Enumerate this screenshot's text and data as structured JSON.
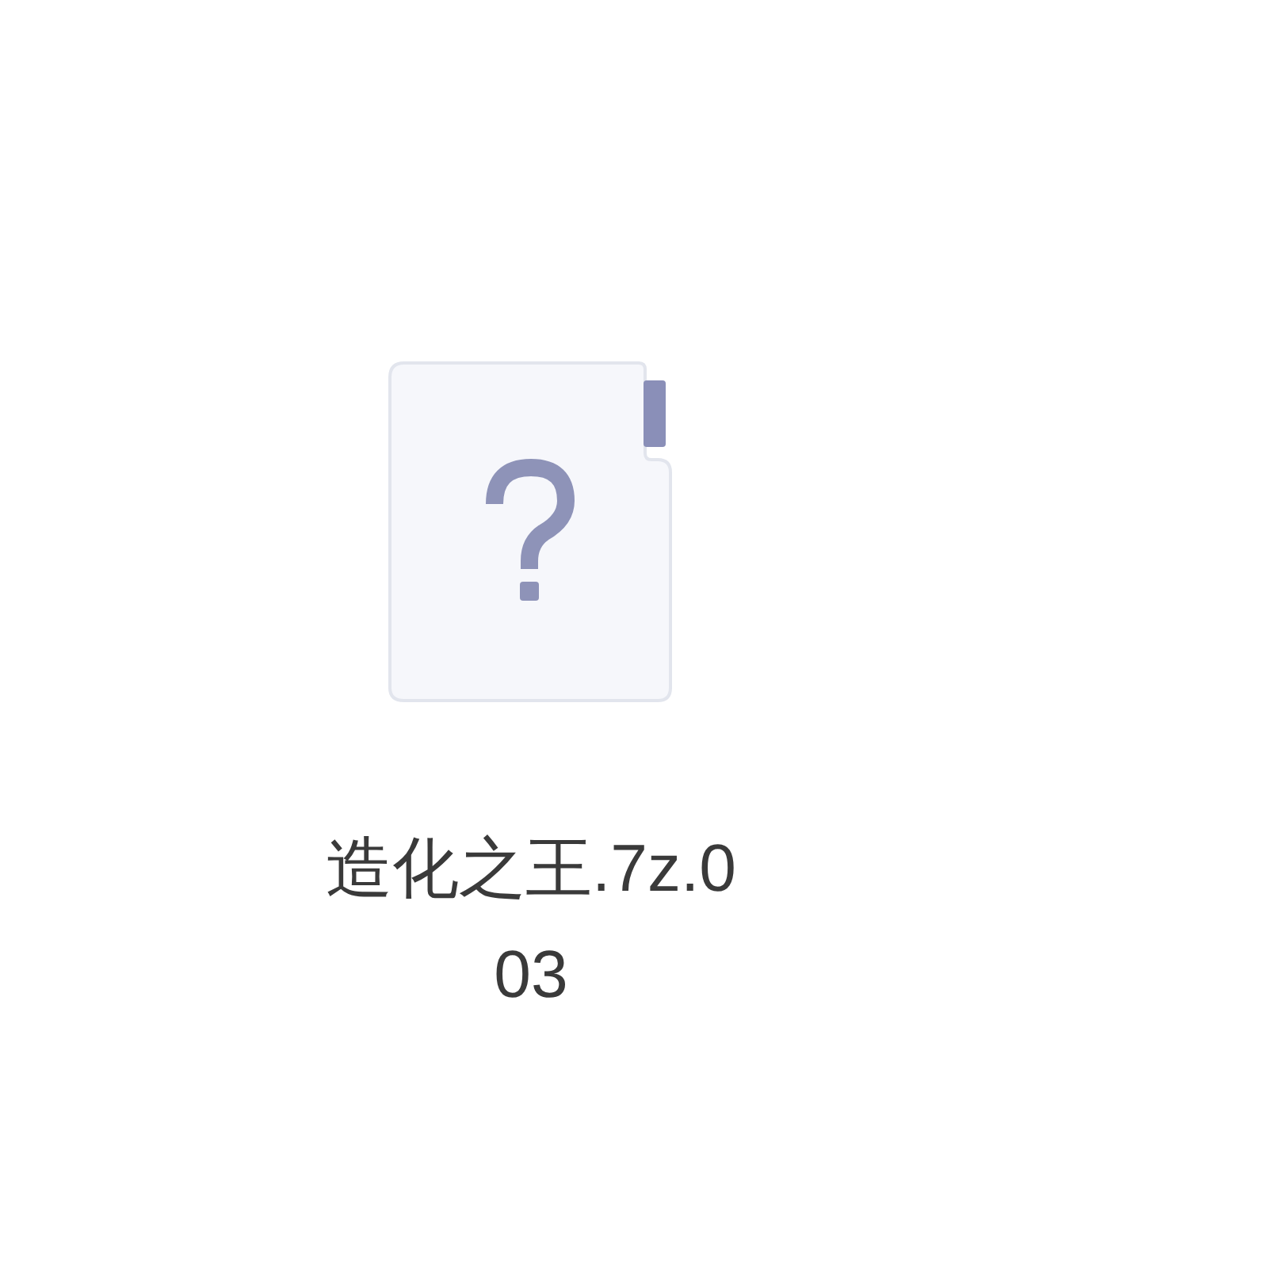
{
  "files": [
    {
      "name": "造化之王.7z.003"
    }
  ]
}
